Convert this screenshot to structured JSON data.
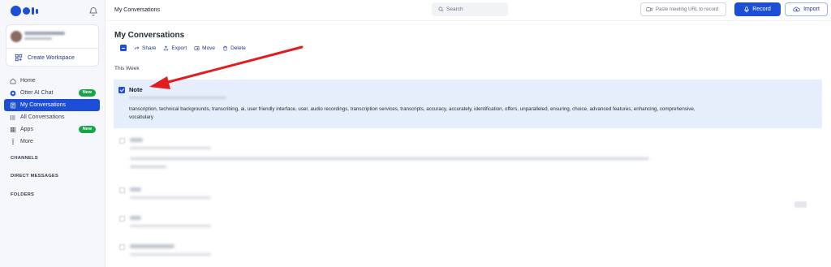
{
  "sidebar": {
    "workspace": {
      "create_label": "Create Workspace"
    },
    "nav": [
      {
        "label": "Home",
        "icon": "home-icon"
      },
      {
        "label": "Otter AI Chat",
        "icon": "chat-icon",
        "badge": "New"
      },
      {
        "label": "My Conversations",
        "icon": "conversations-icon",
        "active": true
      },
      {
        "label": "All Conversations",
        "icon": "list-icon"
      },
      {
        "label": "Apps",
        "icon": "apps-grid-icon",
        "badge": "New"
      },
      {
        "label": "More",
        "icon": "more-vertical-icon"
      }
    ],
    "sections": {
      "channels": "CHANNELS",
      "direct_messages": "DIRECT MESSAGES",
      "folders": "FOLDERS"
    }
  },
  "header": {
    "title": "My Conversations",
    "search_placeholder": "Search",
    "paste_placeholder": "Paste meeting URL to record",
    "record_label": "Record",
    "import_label": "Import"
  },
  "main": {
    "title": "My Conversations",
    "actions": {
      "share": "Share",
      "export": "Export",
      "move": "Move",
      "delete": "Delete"
    },
    "group_label": "This Week",
    "selected_item": {
      "title": "Note",
      "checked": true,
      "keywords": "transcription, technical backgrounds, transcribing, ai, user friendly interface, user, audio recordings, transcription services, transcripts, accuracy, accurately, identification, offers, unparalleled, ensuring, choice, advanced features, enhancing, comprehensive, vocabulary"
    }
  },
  "colors": {
    "accent": "#1d4ed8",
    "badge_green": "#16a34a",
    "selected_row": "#e6eefb",
    "annotation_arrow": "#e11d1d"
  }
}
